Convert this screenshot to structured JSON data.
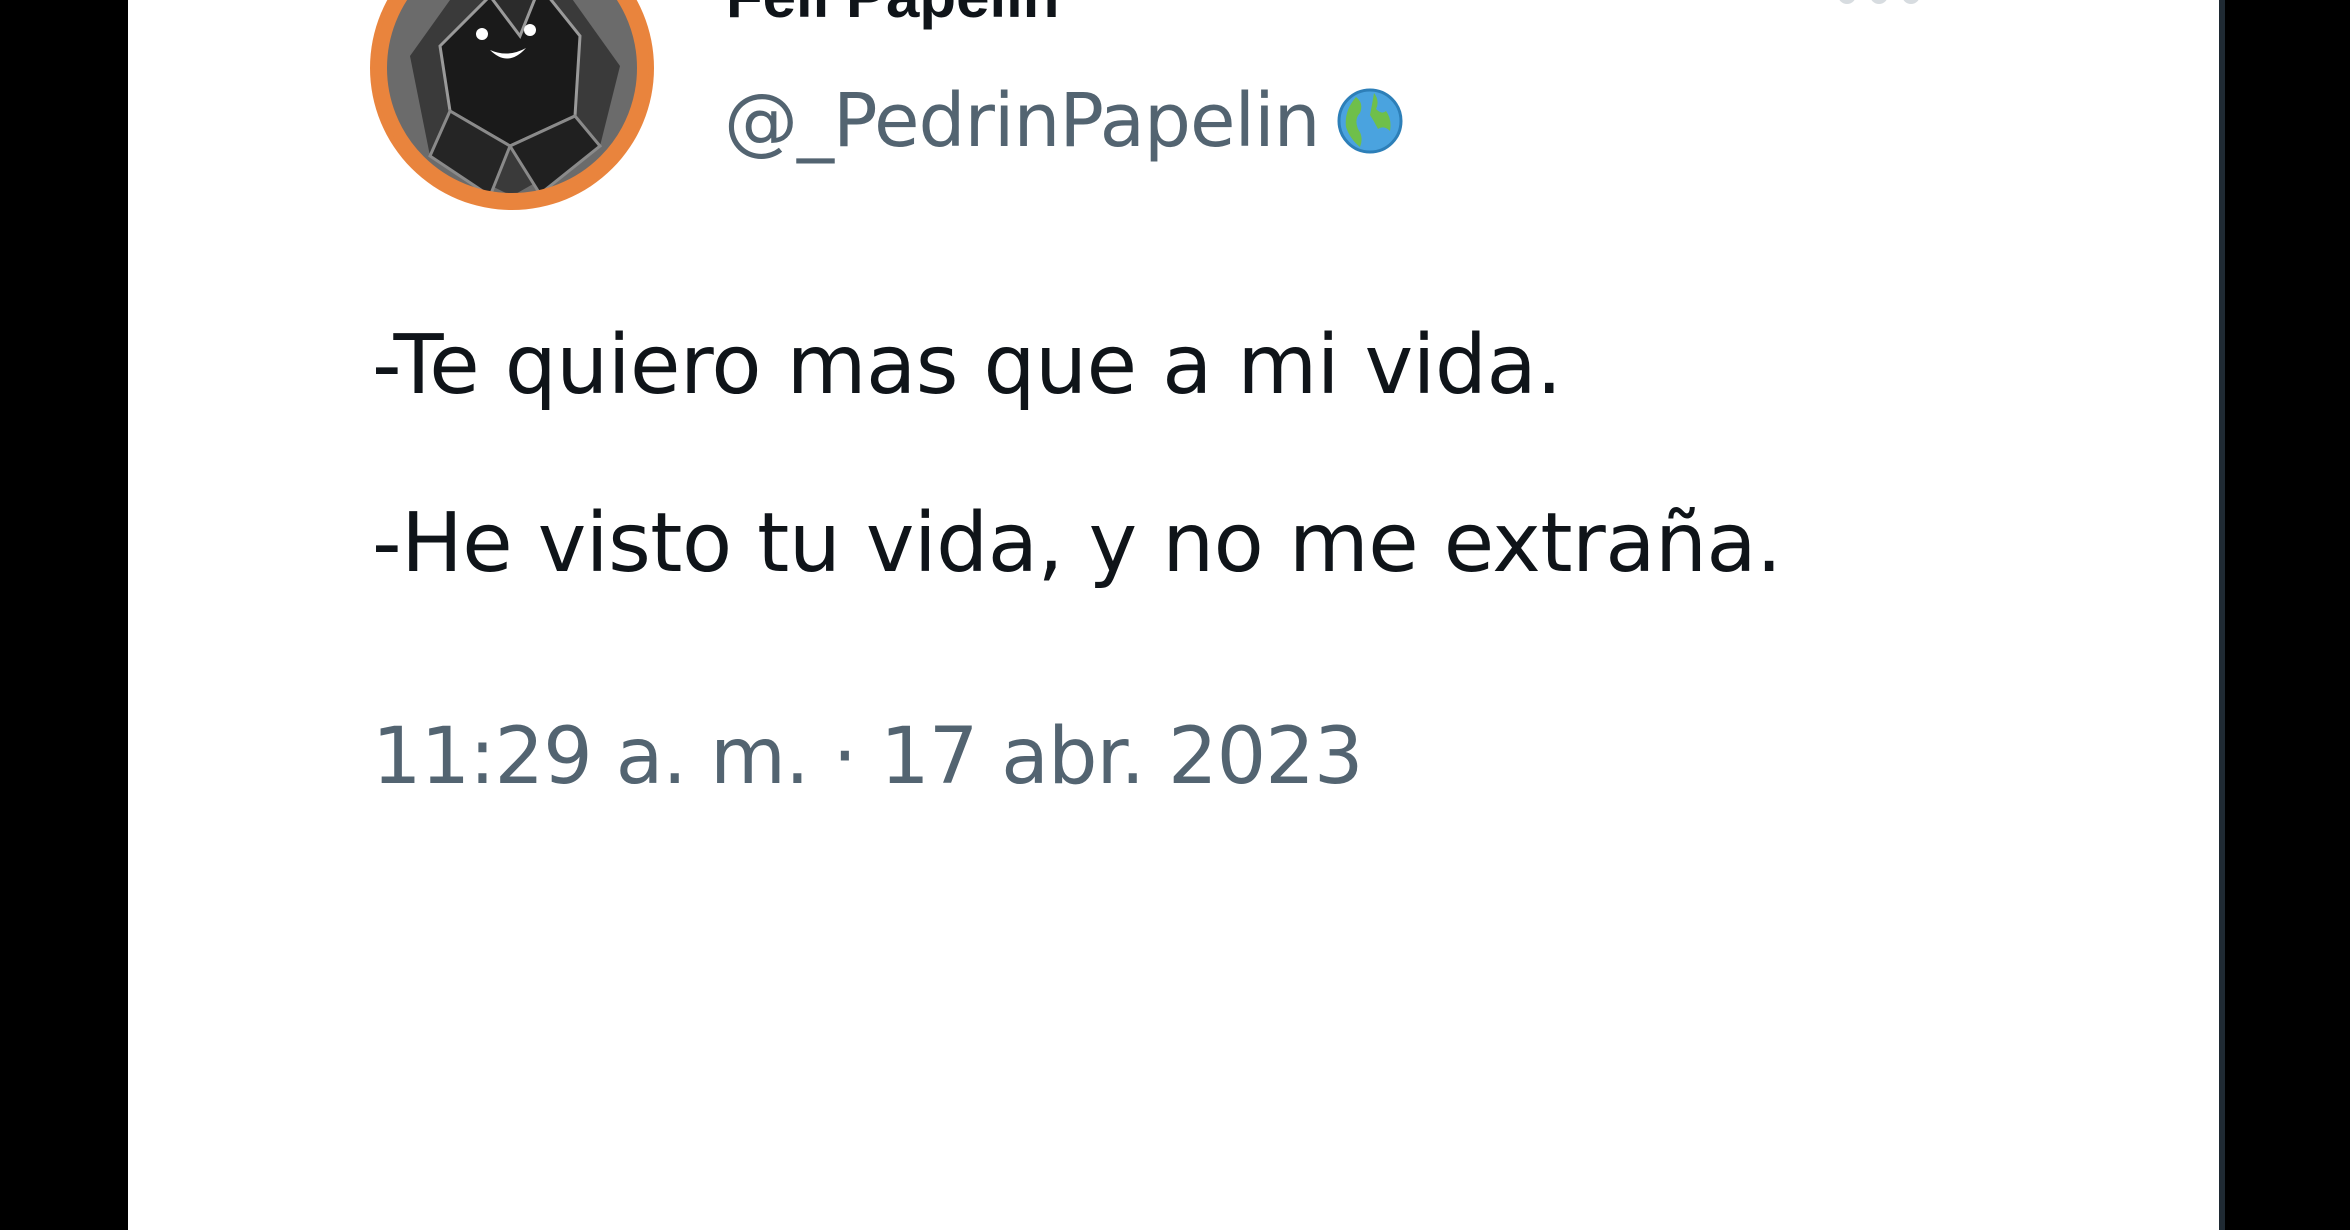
{
  "tweet": {
    "author": {
      "display_name": "Feli Papelin",
      "handle": "@_PedrinPapelin",
      "avatar_icon": "hooded-paper-figure-avatar",
      "badge_icon": "globe-emoji-icon"
    },
    "lines": [
      "-Te quiero mas que a mi vida.",
      "-He visto tu vida, y no me extraña."
    ],
    "timestamp": "11:29 a. m. · 17 abr. 2023"
  },
  "colors": {
    "background": "#000000",
    "card": "#ffffff",
    "primary_text": "#0f1419",
    "secondary_text": "#536471",
    "avatar_ring": "#e9843d"
  }
}
